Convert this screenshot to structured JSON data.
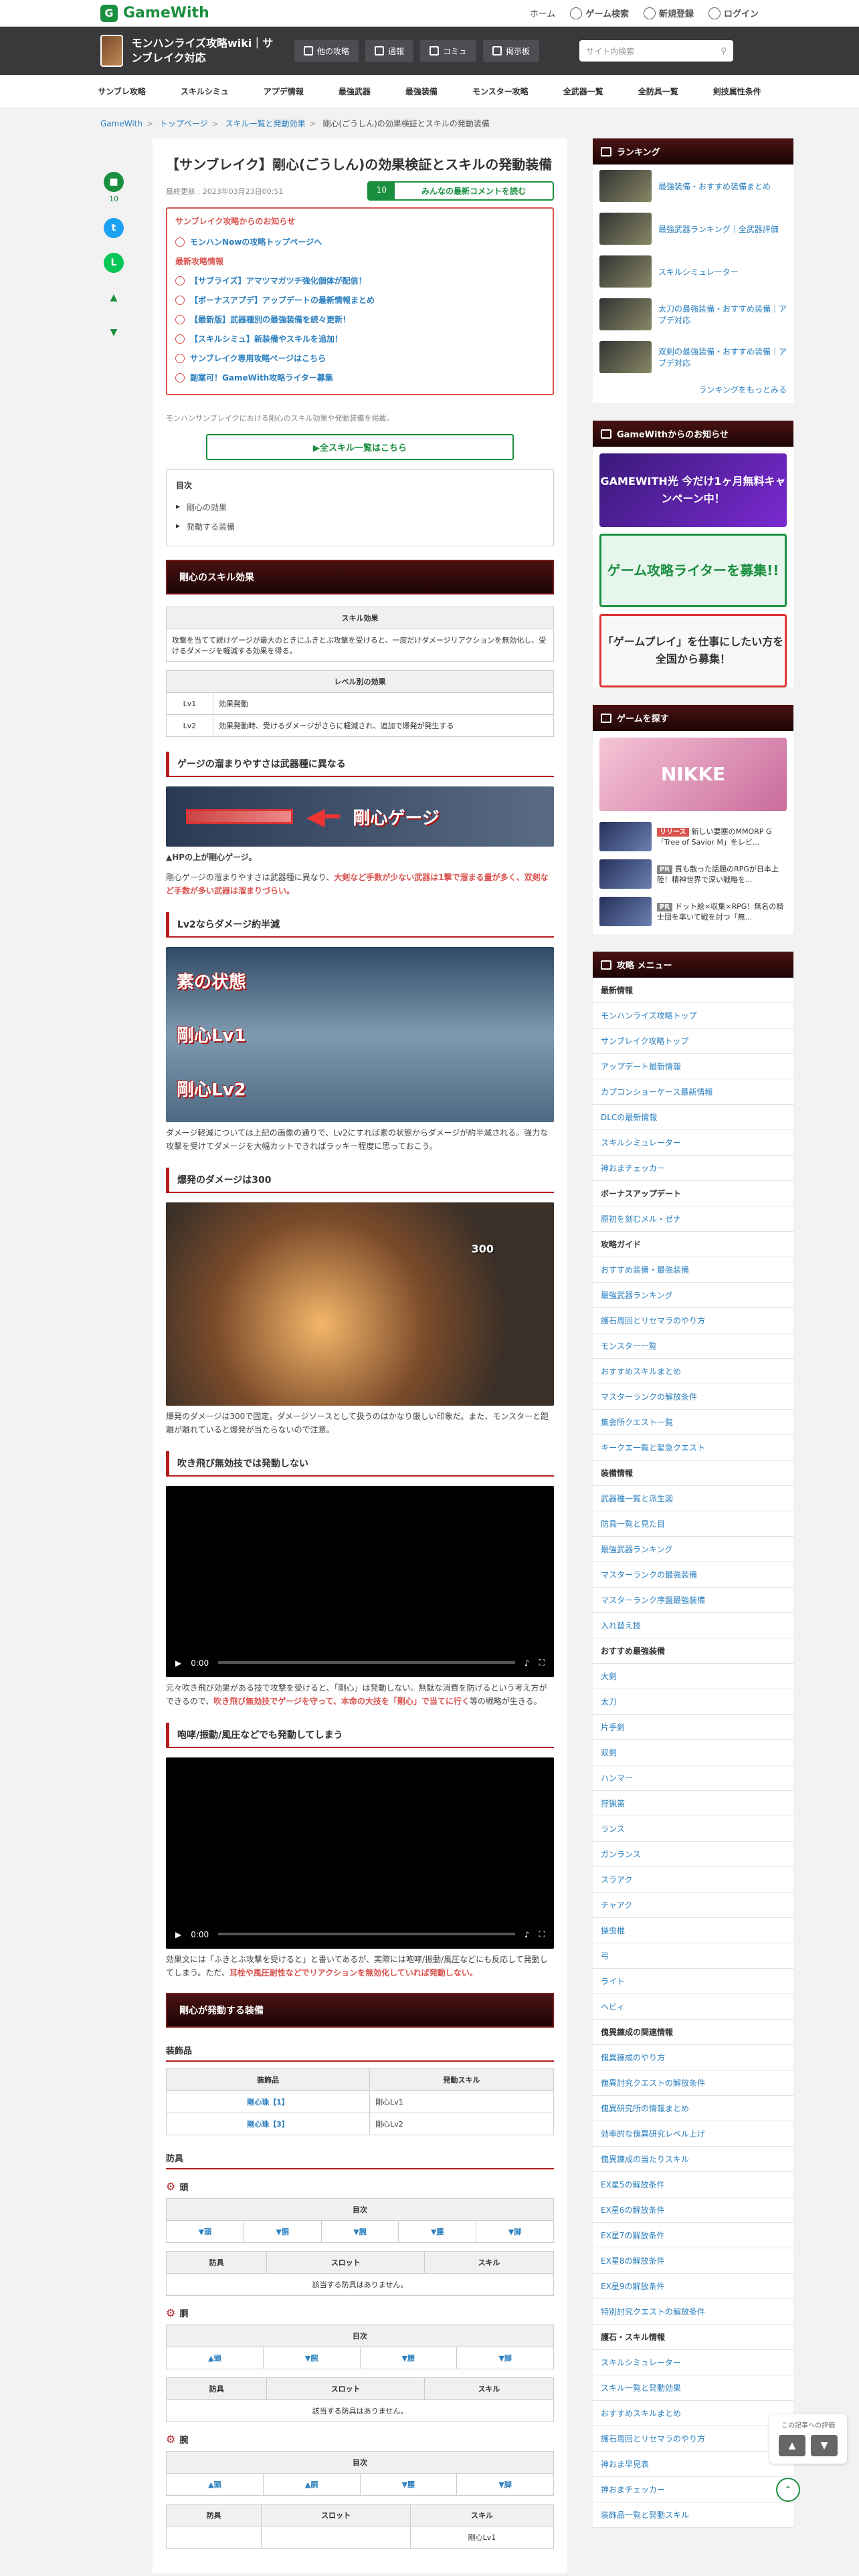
{
  "topbar": {
    "logo": "GameWith",
    "links": [
      "ホーム",
      "ゲーム検索",
      "新規登録",
      "ログイン"
    ]
  },
  "header": {
    "site_title": "モンハンライズ攻略wiki｜サンブレイク対応",
    "buttons": [
      "他の攻略",
      "通報",
      "コミュ",
      "掲示板"
    ],
    "search_placeholder": "サイト内検索"
  },
  "nav": [
    "サンブレ攻略",
    "スキルシミュ",
    "アプデ情報",
    "最強武器",
    "最強装備",
    "モンスター攻略",
    "全武器一覧",
    "全防具一覧",
    "剣技属性条件"
  ],
  "breadcrumbs": [
    "GameWith",
    "トップページ",
    "スキル一覧と発動効果",
    "剛心(ごうしん)の効果検証とスキルの発動装備"
  ],
  "rail": {
    "comment_count": "10"
  },
  "article": {
    "title": "【サンブレイク】剛心(ごうしん)の効果検証とスキルの発動装備",
    "updated": "最終更新 : 2023年03月23日00:51",
    "comment_count": "10",
    "comment_label": "みんなの最新コメントを読む",
    "notice_head": "サンブレイク攻略からのお知らせ",
    "notices": [
      "モンハンNowの攻略トップページへ",
      "最新攻略情報",
      "【サブライズ】アマツマガツチ強化個体が配信！",
      "【ボーナスアプデ】アップデートの最新情報まとめ",
      "【最新版】武器種別の最強装備を続々更新！",
      "【スキルシミュ】新装備やスキルを追加！",
      "サンブレイク専用攻略ページはこちら",
      "副業可！GameWith攻略ライター募集"
    ],
    "lead": "モンハンサンブレイクにおける剛心のスキル効果や発動装備を掲載。",
    "all_skills_btn": "▶全スキル一覧はこちら",
    "toc_title": "目次",
    "toc": [
      "剛心の効果",
      "発動する装備"
    ],
    "sec1": "剛心のスキル効果",
    "skill_table_head": "スキル効果",
    "skill_table_body": "攻撃を当てて続けゲージが最大のときにふきとぶ攻撃を受けると、一度だけダメージリアクションを無効化し、受けるダメージを軽減する効果を得る。",
    "level_table_head": "レベル別の効果",
    "levels": [
      {
        "lv": "Lv1",
        "effect": "効果発動"
      },
      {
        "lv": "Lv2",
        "effect": "効果発動時、受けるダメージがさらに軽減され、追加で爆発が発生する"
      }
    ],
    "h_gauge": "ゲージの溜まりやすさは武器種に異なる",
    "gauge_label": "剛心ゲージ",
    "gauge_caption": "▲HPの上が剛心ゲージ。",
    "gauge_text_a": "剛心ゲージの溜まりやすさは武器種に異なり、",
    "gauge_text_b": "大剣など手数が少ない武器は1撃で溜まる量が多く、双剣など手数が多い武器は溜まりづらい。",
    "h_lv2": "Lv2ならダメージ約半減",
    "lv2_labels": [
      "素の状態",
      "剛心Lv1",
      "剛心Lv2"
    ],
    "lv2_text": "ダメージ軽減については上記の画像の通りで、Lv2にすれば素の状態からダメージが約半減される。強力な攻撃を受けてダメージを大幅カットできればラッキー程度に思っておこう。",
    "h_blast": "爆発のダメージは300",
    "blast_dmg": "300",
    "blast_text": "爆発のダメージは300で固定。ダメージソースとして扱うのはかなり厳しい印象だ。また、モンスターと距離が離れていると爆発が当たらないので注意。",
    "h_inv": "吹き飛び無効技では発動しない",
    "video_time": "0:00",
    "inv_text_a": "元々吹き飛び効果がある技で攻撃を受けると、「剛心」は発動しない。無駄な消費を防げるという考え方ができるので、",
    "inv_text_b": "吹き飛び無効技でゲージを守って、本命の大技を「剛心」で当てに行く",
    "inv_text_c": "等の戦略が生きる。",
    "h_roar": "咆哮/振動/風圧などでも発動してしまう",
    "roar_text_a": "効果文には「ふきとぶ攻撃を受けると」と書いてあるが、実際には咆哮/振動/風圧などにも反応して発動してしまう。ただ、",
    "roar_text_b": "耳栓や風圧耐性などでリアクションを無効化していれば発動しない。",
    "sec2": "剛心が発動する装備",
    "h_deco": "装飾品",
    "deco_head": [
      "装飾品",
      "発動スキル"
    ],
    "decos": [
      {
        "name": "剛心珠【1】",
        "skill": "剛心Lv1"
      },
      {
        "name": "剛心珠【3】",
        "skill": "剛心Lv2"
      }
    ],
    "h_armor": "防具",
    "parts": [
      "頭",
      "胴",
      "腕"
    ],
    "part_toc": "目次",
    "part_toc_cells": [
      [
        "▼頭",
        "▼胴",
        "▼腕",
        "▼腰",
        "▼脚"
      ],
      [
        "▲頭",
        "▼腕",
        "▼腰",
        "▼脚"
      ],
      [
        "▲頭",
        "▲胴",
        "▼腰",
        "▼脚"
      ]
    ],
    "armor_head": [
      "防具",
      "スロット",
      "スキル"
    ],
    "no_armor": "該当する防具はありません。",
    "last_cell": "剛心Lv1"
  },
  "sidebar": {
    "ranking_title": "ランキング",
    "ranking": [
      "最強装備・おすすめ装備まとめ",
      "最強武器ランキング｜全武器評価",
      "スキルシミュレーター",
      "太刀の最強装備・おすすめ装備｜アプデ対応",
      "双剣の最強装備・おすすめ装備｜アプデ対応"
    ],
    "ranking_more": "ランキングをもっとみる",
    "news_title": "GameWithからのお知らせ",
    "banners": [
      "GAMEWITH光 今だけ1ヶ月無料キャンペーン中！",
      "ゲーム攻略ライターを募集!!",
      "「ゲームプレイ」を仕事にしたい方を全国から募集！"
    ],
    "find_title": "ゲームを探す",
    "find_banner": "NIKKE",
    "games": [
      {
        "tag": "リリース",
        "text": "新しい要塞のMMORP G「Tree of Savior M」をレビ..."
      },
      {
        "tag": "PR",
        "text": "貫も散った話題のRPGが日本上陸！精神世界で深い戦略を..."
      },
      {
        "tag": "PR",
        "text": "ドット絵×収集×RPG！無名の騎士団を率いて戦を討つ「無..."
      }
    ],
    "menu_title": "攻略 メニュー",
    "menu": [
      {
        "t": "cat",
        "v": "最新情報"
      },
      {
        "t": "li",
        "v": "モンハンライズ攻略トップ"
      },
      {
        "t": "li",
        "v": "サンブレイク攻略トップ"
      },
      {
        "t": "li",
        "v": "アップデート最新情報"
      },
      {
        "t": "li",
        "v": "カプコンショーケース最新情報"
      },
      {
        "t": "li",
        "v": "DLCの最新情報"
      },
      {
        "t": "li",
        "v": "スキルシミュレーター"
      },
      {
        "t": "li",
        "v": "神おまチェッカー"
      },
      {
        "t": "cat",
        "v": "ボーナスアップデート"
      },
      {
        "t": "li",
        "v": "原初を刻むメル・ゼナ"
      },
      {
        "t": "cat",
        "v": "攻略ガイド"
      },
      {
        "t": "li",
        "v": "おすすめ装備・最強装備"
      },
      {
        "t": "li",
        "v": "最強武器ランキング"
      },
      {
        "t": "li",
        "v": "護石周回とリセマラのやり方"
      },
      {
        "t": "li",
        "v": "モンスター一覧"
      },
      {
        "t": "li",
        "v": "おすすめスキルまとめ"
      },
      {
        "t": "li",
        "v": "マスターランクの解放条件"
      },
      {
        "t": "li",
        "v": "集会所クエスト一覧"
      },
      {
        "t": "li",
        "v": "キークエ一覧と緊急クエスト"
      },
      {
        "t": "cat",
        "v": "装備情報"
      },
      {
        "t": "li",
        "v": "武器種一覧と派生図"
      },
      {
        "t": "li",
        "v": "防具一覧と見た目"
      },
      {
        "t": "li",
        "v": "最強武器ランキング"
      },
      {
        "t": "li",
        "v": "マスターランクの最強装備"
      },
      {
        "t": "li",
        "v": "マスターランク序盤最強装備"
      },
      {
        "t": "li",
        "v": "入れ替え技"
      },
      {
        "t": "cat",
        "v": "おすすめ最強装備"
      },
      {
        "t": "li",
        "v": "大剣"
      },
      {
        "t": "li",
        "v": "太刀"
      },
      {
        "t": "li",
        "v": "片手剣"
      },
      {
        "t": "li",
        "v": "双剣"
      },
      {
        "t": "li",
        "v": "ハンマー"
      },
      {
        "t": "li",
        "v": "狩猟笛"
      },
      {
        "t": "li",
        "v": "ランス"
      },
      {
        "t": "li",
        "v": "ガンランス"
      },
      {
        "t": "li",
        "v": "スラアク"
      },
      {
        "t": "li",
        "v": "チャアク"
      },
      {
        "t": "li",
        "v": "操虫棍"
      },
      {
        "t": "li",
        "v": "弓"
      },
      {
        "t": "li",
        "v": "ライト"
      },
      {
        "t": "li",
        "v": "ヘビィ"
      },
      {
        "t": "cat",
        "v": "傀異錬成の関連情報"
      },
      {
        "t": "li",
        "v": "傀異錬成のやり方"
      },
      {
        "t": "li",
        "v": "傀異討究クエストの解放条件"
      },
      {
        "t": "li",
        "v": "傀異研究所の情報まとめ"
      },
      {
        "t": "li",
        "v": "効率的な傀異研究レベル上げ"
      },
      {
        "t": "li",
        "v": "傀異錬成の当たりスキル"
      },
      {
        "t": "li",
        "v": "EX星5の解放条件"
      },
      {
        "t": "li",
        "v": "EX星6の解放条件"
      },
      {
        "t": "li",
        "v": "EX星7の解放条件"
      },
      {
        "t": "li",
        "v": "EX星8の解放条件"
      },
      {
        "t": "li",
        "v": "EX星9の解放条件"
      },
      {
        "t": "li",
        "v": "特別討究クエストの解放条件"
      },
      {
        "t": "cat",
        "v": "護石・スキル情報"
      },
      {
        "t": "li",
        "v": "スキルシミュレーター"
      },
      {
        "t": "li",
        "v": "スキル一覧と発動効果"
      },
      {
        "t": "li",
        "v": "おすすめスキルまとめ"
      },
      {
        "t": "li",
        "v": "護石周回とリセマラのやり方"
      },
      {
        "t": "li",
        "v": "神おま早見表"
      },
      {
        "t": "li",
        "v": "神おまチェッカー"
      },
      {
        "t": "li",
        "v": "装飾品一覧と発動スキル"
      }
    ]
  },
  "floater": {
    "label": "この記事への評価"
  },
  "colors": {
    "brand": "#1a8f3f",
    "accent": "#b51f1f",
    "link": "#2a7fbf"
  }
}
